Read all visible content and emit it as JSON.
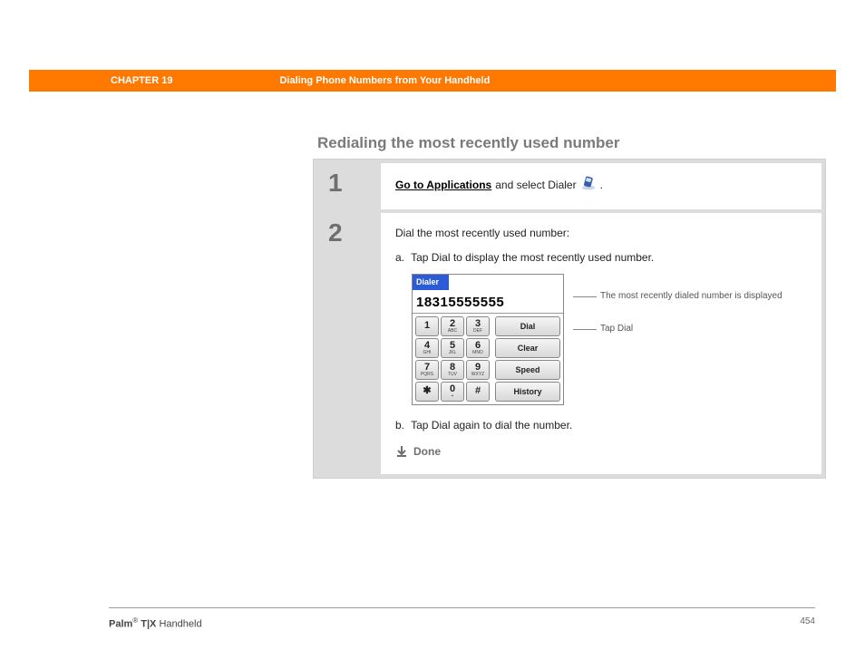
{
  "header": {
    "chapter": "CHAPTER 19",
    "title": "Dialing Phone Numbers from Your Handheld"
  },
  "section_title": "Redialing the most recently used number",
  "step1": {
    "num": "1",
    "link": "Go to Applications",
    "rest": " and select Dialer ",
    "period": "."
  },
  "step2": {
    "num": "2",
    "intro": "Dial the most recently used number:",
    "a_label": "a.",
    "a_text": "Tap Dial to display the most recently used number.",
    "b_label": "b.",
    "b_text": "Tap Dial again to dial the number.",
    "done": "Done"
  },
  "dialer": {
    "title": "Dialer",
    "display": "18315555555",
    "keys": {
      "k1": "1",
      "k2": "2",
      "k2s": "ABC",
      "k3": "3",
      "k3s": "DEF",
      "k4": "4",
      "k4s": "GHI",
      "k5": "5",
      "k5s": "JKL",
      "k6": "6",
      "k6s": "MNO",
      "k7": "7",
      "k7s": "PQRS",
      "k8": "8",
      "k8s": "TUV",
      "k9": "9",
      "k9s": "WXYZ",
      "kstar": "✱",
      "k0": "0",
      "k0s": "+",
      "khash": "#"
    },
    "buttons": {
      "dial": "Dial",
      "clear": "Clear",
      "speed": "Speed",
      "history": "History"
    }
  },
  "annotations": {
    "display_note": "The most recently dialed number is displayed",
    "dial_note": "Tap Dial"
  },
  "footer": {
    "brand": "Palm",
    "reg": "®",
    "model": " T|X",
    "product": " Handheld",
    "page": "454"
  }
}
